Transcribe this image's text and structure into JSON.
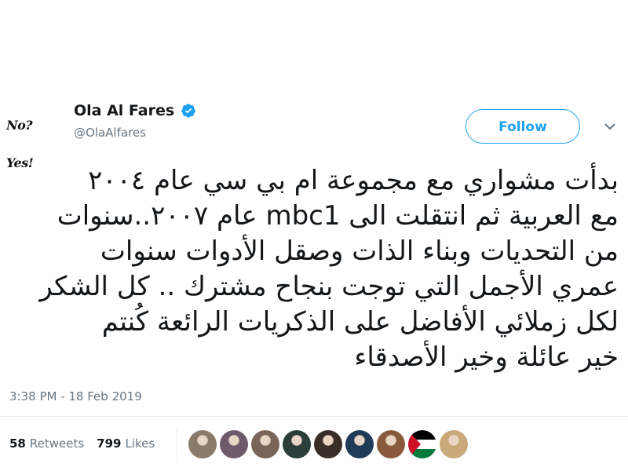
{
  "user": {
    "avatar_text": "No? Yes!",
    "name": "Ola Al Fares",
    "handle": "@OlaAlfares",
    "verified_icon": "verified-badge-icon",
    "follow_label": "Follow"
  },
  "tweet": {
    "lines": [
      "بدأت مشواري مع مجموعة ام بي سي عام ٢٠٠٤",
      "مع العربية ثم انتقلت الى mbc1 عام ٢٠٠٧..سنوات",
      "من التحديات وبناء الذات وصقل الأدوات سنوات",
      "عمري الأجمل التي توجت بنجاح مشترك .. كل الشكر",
      "لكل زملائي الأفاضل على الذكريات الرائعة كُنتم",
      "خير عائلة وخير الأصدقاء"
    ],
    "timestamp": "3:38 PM - 18 Feb 2019"
  },
  "stats": {
    "retweets_count": "58",
    "retweets_label": "Retweets",
    "likes_count": "799",
    "likes_label": "Likes"
  },
  "colors": {
    "accent": "#1da1f2",
    "text": "#14171a",
    "secondary": "#657786",
    "divider": "#e6ecf0"
  },
  "likers": [
    {
      "icon": "liker-avatar-1",
      "color": "#8a7a6a"
    },
    {
      "icon": "liker-avatar-2",
      "color": "#6e5a6a"
    },
    {
      "icon": "liker-avatar-3",
      "color": "#7a6458"
    },
    {
      "icon": "liker-avatar-4",
      "color": "#2c3e3a"
    },
    {
      "icon": "liker-avatar-5",
      "color": "#3a2e28"
    },
    {
      "icon": "liker-avatar-6",
      "color": "#1f3b57"
    },
    {
      "icon": "liker-avatar-7",
      "color": "#8a5a3c"
    },
    {
      "icon": "palestine-flag-avatar",
      "color": "#007a3d"
    },
    {
      "icon": "liker-avatar-9",
      "color": "#c9a97a"
    }
  ]
}
